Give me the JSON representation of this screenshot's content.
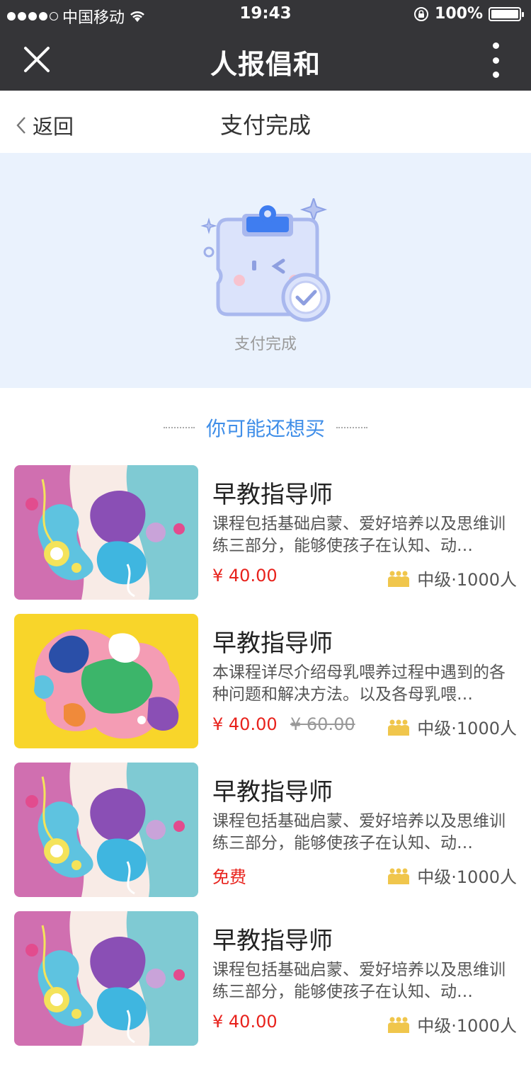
{
  "status_bar": {
    "carrier": "中国移动",
    "time": "19:43",
    "battery": "100%",
    "battery_level": 1.0
  },
  "nav": {
    "title": "人报倡和",
    "close_icon": "close-icon",
    "more_icon": "more-vertical-icon"
  },
  "page": {
    "back_label": "返回",
    "title": "支付完成"
  },
  "success": {
    "text": "支付完成",
    "icon": "payment-success-illustration"
  },
  "recommend": {
    "title": "你可能还想买"
  },
  "colors": {
    "accent": "#3f8ee8",
    "price": "#e8221c",
    "banner_bg": "#eaf2fd",
    "topbar": "#353538",
    "people_icon": "#f0c64c"
  },
  "products": [
    {
      "title": "早教指导师",
      "desc": "课程包括基础启蒙、爱好培养以及思维训练三部分，能够使孩子在认知、动…",
      "price": "¥ 40.00",
      "old_price": "",
      "meta": "中级·1000人",
      "thumb": "abstract-pink-teal"
    },
    {
      "title": "早教指导师",
      "desc": "本课程详尽介绍母乳喂养过程中遇到的各种问题和解决方法。以及各母乳喂…",
      "price": "¥ 40.00",
      "old_price": "¥ 60.00",
      "meta": "中级·1000人",
      "thumb": "abstract-yellow"
    },
    {
      "title": "早教指导师",
      "desc": "课程包括基础启蒙、爱好培养以及思维训练三部分，能够使孩子在认知、动…",
      "price": "免费",
      "old_price": "",
      "meta": "中级·1000人",
      "thumb": "abstract-pink-teal"
    },
    {
      "title": "早教指导师",
      "desc": "课程包括基础启蒙、爱好培养以及思维训练三部分，能够使孩子在认知、动…",
      "price": "¥ 40.00",
      "old_price": "",
      "meta": "中级·1000人",
      "thumb": "abstract-pink-teal"
    }
  ]
}
